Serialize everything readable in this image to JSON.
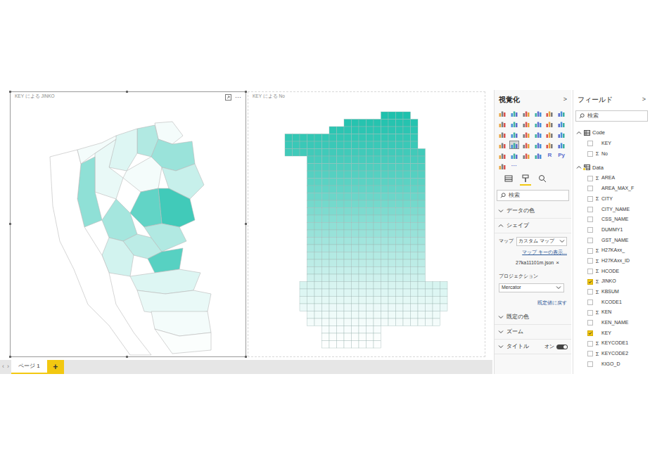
{
  "visuals": [
    {
      "title": "KEY による JINKO",
      "selected": true,
      "more": "···"
    },
    {
      "title": "KEY による No",
      "selected": false
    }
  ],
  "jinko_map": {
    "region_levels": [
      0.05,
      0.35,
      0.15,
      0.45,
      0.1,
      0.5,
      0.05,
      0.25,
      0.85,
      0.7,
      0.4,
      0.3,
      0.35,
      0.75,
      0.2,
      0.15,
      0.1,
      0.05,
      0.02,
      0,
      0.05
    ]
  },
  "no_map": {
    "row_levels": [
      1,
      0.97,
      0.94,
      0.91,
      0.88,
      0.85,
      0.82,
      0.79,
      0.76,
      0.73,
      0.7,
      0.66,
      0.62,
      0.58,
      0.54,
      0.5,
      0.46,
      0.42,
      0.38,
      0.34,
      0.3,
      0.26,
      0.22,
      0.18,
      0.15,
      0.12,
      0.09,
      0.07,
      0.05,
      0.03,
      0.02,
      0.01
    ]
  },
  "page_tabs": [
    {
      "label": "ページ 1",
      "selected": true
    }
  ],
  "add_page": "+",
  "page_nav": [
    "‹",
    "›"
  ],
  "viz_pane": {
    "title": "視覚化",
    "collapse": ">",
    "gallery": [
      {
        "kind": "icon",
        "selected": false
      },
      {
        "kind": "icon",
        "selected": false
      },
      {
        "kind": "icon",
        "selected": false
      },
      {
        "kind": "icon",
        "selected": false
      },
      {
        "kind": "icon",
        "selected": false
      },
      {
        "kind": "icon",
        "selected": false
      },
      {
        "kind": "icon",
        "selected": false
      },
      {
        "kind": "icon",
        "selected": false
      },
      {
        "kind": "icon",
        "selected": false
      },
      {
        "kind": "icon",
        "selected": false
      },
      {
        "kind": "icon",
        "selected": false
      },
      {
        "kind": "icon",
        "selected": false
      },
      {
        "kind": "icon",
        "selected": false
      },
      {
        "kind": "icon",
        "selected": false
      },
      {
        "kind": "icon",
        "selected": false
      },
      {
        "kind": "icon",
        "selected": false
      },
      {
        "kind": "icon",
        "selected": false
      },
      {
        "kind": "icon",
        "selected": false
      },
      {
        "kind": "icon",
        "selected": false
      },
      {
        "kind": "icon",
        "selected": true
      },
      {
        "kind": "icon",
        "selected": false
      },
      {
        "kind": "icon",
        "selected": false
      },
      {
        "kind": "icon",
        "selected": false
      },
      {
        "kind": "icon",
        "selected": false
      },
      {
        "kind": "icon",
        "selected": false
      },
      {
        "kind": "icon",
        "selected": false
      },
      {
        "kind": "icon",
        "selected": false
      },
      {
        "kind": "icon",
        "selected": false
      },
      {
        "kind": "text",
        "label": "R",
        "selected": false
      },
      {
        "kind": "text",
        "label": "Py",
        "selected": false
      },
      {
        "kind": "icon",
        "selected": false
      },
      {
        "kind": "text",
        "label": "···",
        "selected": false
      }
    ],
    "tabs": [
      {
        "name": "fields",
        "selected": false
      },
      {
        "name": "format",
        "selected": true
      },
      {
        "name": "analytics",
        "selected": false
      }
    ],
    "search": {
      "placeholder": "検索"
    },
    "sections": [
      {
        "label": "データの色",
        "expanded": false
      },
      {
        "label": "シェイプ",
        "expanded": true,
        "details": {
          "map_label": "マップ",
          "map_value": "カスタム マップ",
          "map_key_link": "マップ キーの表示...",
          "file": "27ka11101m.json",
          "file_remove": "×",
          "projection_label": "プロジェクション",
          "projection_value": "Mercator",
          "reset": "既定値に戻す"
        }
      },
      {
        "label": "既定の色",
        "expanded": false
      },
      {
        "label": "ズーム",
        "expanded": false
      },
      {
        "label": "タイトル",
        "expanded": false,
        "toggle": {
          "label": "オン",
          "on": true
        }
      }
    ]
  },
  "fields_pane": {
    "title": "フィールド",
    "collapse": ">",
    "search": {
      "placeholder": "検索"
    },
    "tables": [
      {
        "name": "Code",
        "expanded": true,
        "in_use": false,
        "items": [
          {
            "label": "KEY",
            "prefix": "",
            "checked": false
          },
          {
            "label": "No",
            "prefix": "Σ",
            "checked": false
          }
        ]
      },
      {
        "name": "Data",
        "expanded": true,
        "in_use": true,
        "items": [
          {
            "label": "AREA",
            "prefix": "Σ",
            "checked": false
          },
          {
            "label": "AREA_MAX_F",
            "prefix": "",
            "checked": false
          },
          {
            "label": "CITY",
            "prefix": "Σ",
            "checked": false
          },
          {
            "label": "CITY_NAME",
            "prefix": "",
            "checked": false
          },
          {
            "label": "CSS_NAME",
            "prefix": "",
            "checked": false
          },
          {
            "label": "DUMMY1",
            "prefix": "",
            "checked": false
          },
          {
            "label": "GST_NAME",
            "prefix": "",
            "checked": false
          },
          {
            "label": "H27KAxx_",
            "prefix": "Σ",
            "checked": false
          },
          {
            "label": "H27KAxx_ID",
            "prefix": "Σ",
            "checked": false
          },
          {
            "label": "HCODE",
            "prefix": "Σ",
            "checked": false
          },
          {
            "label": "JINKO",
            "prefix": "Σ",
            "checked": true
          },
          {
            "label": "KBSUM",
            "prefix": "Σ",
            "checked": false
          },
          {
            "label": "KCODE1",
            "prefix": "",
            "checked": false
          },
          {
            "label": "KEN",
            "prefix": "Σ",
            "checked": false
          },
          {
            "label": "KEN_NAME",
            "prefix": "",
            "checked": false
          },
          {
            "label": "KEY",
            "prefix": "",
            "checked": true
          },
          {
            "label": "KEYCODE1",
            "prefix": "Σ",
            "checked": false
          },
          {
            "label": "KEYCODE2",
            "prefix": "Σ",
            "checked": false
          },
          {
            "label": "KIGO_D",
            "prefix": "",
            "checked": false
          }
        ]
      }
    ]
  }
}
